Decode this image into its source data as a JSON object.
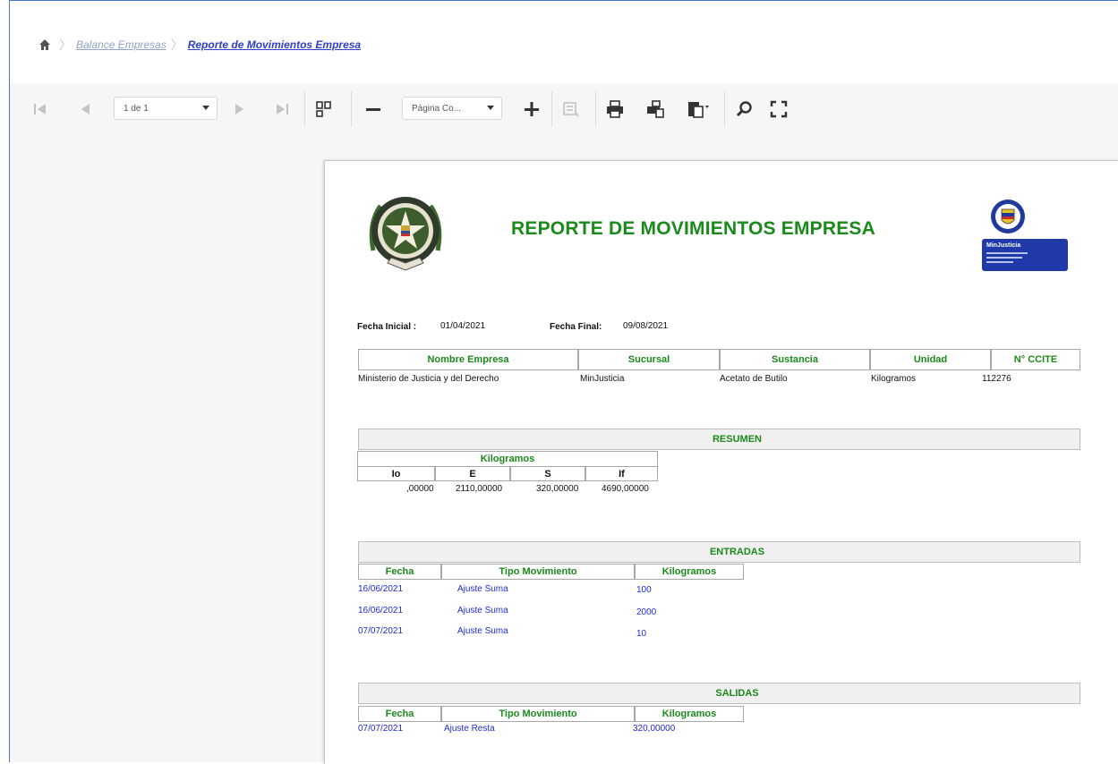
{
  "breadcrumb": {
    "home_icon": "home-icon",
    "items": [
      "Balance Empresas",
      "Reporte de Movimientos Empresa"
    ]
  },
  "toolbar": {
    "page_select_value": "1 de 1",
    "zoom_select_value": "Página Co...",
    "icons": [
      "first-page-icon",
      "prev-page-icon",
      "next-page-icon",
      "last-page-icon",
      "multipage-icon",
      "zoom-out-icon",
      "zoom-in-icon",
      "highlight-icon",
      "print-icon",
      "print-page-icon",
      "export-icon",
      "search-icon",
      "fullscreen-icon"
    ]
  },
  "report": {
    "title": "REPORTE DE MOVIMIENTOS EMPRESA",
    "logo_right_text": "MinJusticia",
    "fecha_inicial_label": "Fecha Inicial :",
    "fecha_inicial": "01/04/2021",
    "fecha_final_label": "Fecha Final:",
    "fecha_final": "09/08/2021",
    "main_table": {
      "headers": [
        "Nombre Empresa",
        "Sucursal",
        "Sustancia",
        "Unidad",
        "N° CCITE"
      ],
      "row": [
        "Ministerio de Justicia y del Derecho",
        "MinJusticia",
        "Acetato de Butilo",
        "Kilogramos",
        "112276"
      ]
    },
    "resumen": {
      "title": "RESUMEN",
      "unit_header": "Kilogramos",
      "headers": [
        "Io",
        "E",
        "S",
        "If"
      ],
      "values": [
        ",00000",
        "2110,00000",
        "320,00000",
        "4690,00000"
      ]
    },
    "entradas": {
      "title": "ENTRADAS",
      "headers": [
        "Fecha",
        "Tipo Movimiento",
        "Kilogramos"
      ],
      "rows": [
        [
          "16/06/2021",
          "Ajuste Suma",
          "100"
        ],
        [
          "16/06/2021",
          "Ajuste Suma",
          "2000"
        ],
        [
          "07/07/2021",
          "Ajuste Suma",
          "10"
        ]
      ]
    },
    "salidas": {
      "title": "SALIDAS",
      "headers": [
        "Fecha",
        "Tipo Movimiento",
        "Kilogramos"
      ],
      "rows": [
        [
          "07/07/2021",
          "Ajuste Resta",
          "320,00000"
        ]
      ]
    }
  }
}
